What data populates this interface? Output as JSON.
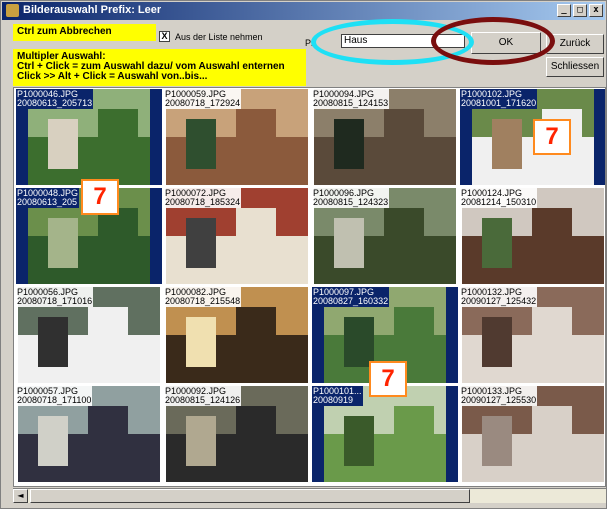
{
  "window": {
    "title": "Bilderauswahl Prefix: Leer",
    "minimize": "_",
    "maximize": "□",
    "close": "x"
  },
  "info": {
    "cancel_hint": "Ctrl zum Abbrechen",
    "multi_line1": "Multipler Auswahl:",
    "multi_line2": "Ctrl + Click = zum Auswahl dazu/ vom Auswahl enternen",
    "multi_line3": "Click >> Alt + Click = Auswahl von..bis..."
  },
  "options": {
    "remove_from_list_label": "Aus der Liste nehmen",
    "remove_from_list_checked": "X"
  },
  "prefix": {
    "label": "Pr",
    "value": "Haus"
  },
  "buttons": {
    "ok": "OK",
    "back": "Zurück",
    "close": "Schliessen"
  },
  "badges": {
    "label": "7"
  },
  "thumbnails": [
    {
      "name": "P1000046.JPG",
      "date": "20080613_205713",
      "selected": true,
      "palette": [
        "#3c6e2e",
        "#8fb07a",
        "#d8d0c0"
      ]
    },
    {
      "name": "P1000059.JPG",
      "date": "20080718_172924",
      "selected": false,
      "palette": [
        "#8b5a3c",
        "#c8a27a",
        "#2f4f2f"
      ]
    },
    {
      "name": "P1000094.JPG",
      "date": "20080815_124153",
      "selected": false,
      "palette": [
        "#5a4a3a",
        "#8c7f6a",
        "#1f2a1f"
      ]
    },
    {
      "name": "P1000102.JPG",
      "date": "20081001_171620",
      "selected": true,
      "palette": [
        "#f0f0f0",
        "#6a8a4a",
        "#a08060"
      ]
    },
    {
      "name": "P1000048.JPG",
      "date": "20080613_205",
      "selected": true,
      "palette": [
        "#2e5a2a",
        "#6b8f4b",
        "#a4b48a"
      ]
    },
    {
      "name": "P1000072.JPG",
      "date": "20080718_185324",
      "selected": false,
      "palette": [
        "#e8e0d0",
        "#a04030",
        "#404040"
      ]
    },
    {
      "name": "P1000096.JPG",
      "date": "20080815_124323",
      "selected": false,
      "palette": [
        "#3a4a2a",
        "#7a8a6a",
        "#c0c0b0"
      ]
    },
    {
      "name": "P1000124.JPG",
      "date": "20081214_150310",
      "selected": false,
      "palette": [
        "#5a3a2a",
        "#d0c8c0",
        "#4a6a3a"
      ]
    },
    {
      "name": "P1000056.JPG",
      "date": "20080718_171016",
      "selected": false,
      "palette": [
        "#f0f0f0",
        "#607060",
        "#303030"
      ]
    },
    {
      "name": "P1000082.JPG",
      "date": "20080718_215548",
      "selected": false,
      "palette": [
        "#3a2a1a",
        "#c09050",
        "#f0e0b0"
      ]
    },
    {
      "name": "P1000097.JPG",
      "date": "20080827_160332",
      "selected": true,
      "palette": [
        "#4a7a3a",
        "#90a870",
        "#2a4a2a"
      ]
    },
    {
      "name": "P1000132.JPG",
      "date": "20090127_125432",
      "selected": false,
      "palette": [
        "#e0d8d0",
        "#8a6a5a",
        "#503a30"
      ]
    },
    {
      "name": "P1000057.JPG",
      "date": "20080718_171100",
      "selected": false,
      "palette": [
        "#303040",
        "#90a0a0",
        "#d0d0c8"
      ]
    },
    {
      "name": "P1000092.JPG",
      "date": "20080815_124126",
      "selected": false,
      "palette": [
        "#2a2a2a",
        "#6a6a5a",
        "#b0a890"
      ]
    },
    {
      "name": "P1000101...",
      "date": "20080919",
      "selected": true,
      "palette": [
        "#6a9a4a",
        "#c0d0b0",
        "#3a5a2a"
      ]
    },
    {
      "name": "P1000133.JPG",
      "date": "20090127_125530",
      "selected": false,
      "palette": [
        "#d8d0c8",
        "#7a5a4a",
        "#9a8a80"
      ]
    }
  ]
}
